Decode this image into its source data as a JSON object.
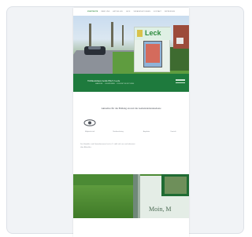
{
  "nav": {
    "items": [
      "STARTSEITE",
      "ÜBER UNS",
      "AKTUELLES",
      "LECK",
      "VERANSTALTUNGEN",
      "KONTAKT",
      "IMPRESSUM"
    ]
  },
  "hero": {
    "sign_text": "Leck"
  },
  "banner": {
    "title": "Willkommen beim HGV Leck",
    "subtitle": "HANDEL · GEWERBE · DIENSTLEISTUNG"
  },
  "intro": {
    "heading": "Aktuelles für die Bildung an und die Gemeindelandesebene"
  },
  "features": [
    {
      "label": "Mitgliedschaft",
      "icon": "eye-icon"
    },
    {
      "label": "Stadtmarketing",
      "icon": "blank-icon"
    },
    {
      "label": "Angebote",
      "icon": "blank-icon"
    },
    {
      "label": "Kontakt",
      "icon": "blank-icon"
    }
  ],
  "paragraph": "Der Handels- und Gewerbeverein Leck e.V. stellt sich vor und informiert über Aktuelles.",
  "photo2": {
    "sign_text": "Moin, M"
  },
  "colors": {
    "brand_green": "#1e7a3d",
    "background": "#f1f3f6"
  }
}
